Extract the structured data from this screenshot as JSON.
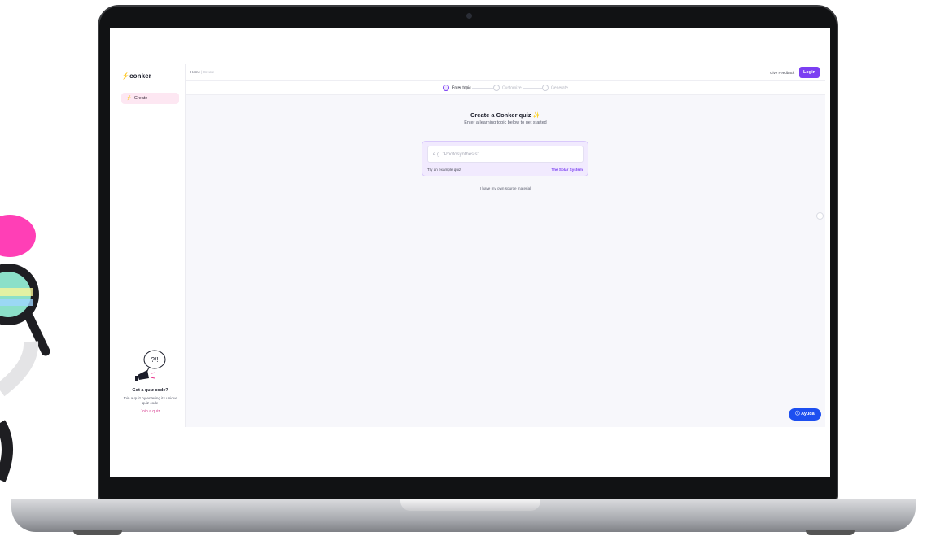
{
  "app": {
    "logo": "conker",
    "logo_icon": "bolt-icon",
    "accent_color": "#7b3ff2",
    "pink_color": "#e8318a"
  },
  "sidebar": {
    "items": [
      {
        "label": "Create",
        "icon": "bolt-icon",
        "active": true
      }
    ],
    "quiz_code": {
      "title": "Got a quiz code?",
      "text": "Join a quiz by entering its unique quiz code",
      "link": "Join a quiz",
      "illustration_text": "?/!"
    }
  },
  "header": {
    "breadcrumb": [
      "Home",
      "Create"
    ],
    "breadcrumb_separator": "|",
    "feedback_label": "Give Feedback",
    "login_label": "Login"
  },
  "steps": [
    {
      "label": "Enter topic",
      "state": "active"
    },
    {
      "label": "Customize",
      "state": "inactive"
    },
    {
      "label": "Generate",
      "state": "inactive"
    }
  ],
  "main": {
    "title": "Create a Conker quiz",
    "title_icon": "sparkle-icon",
    "subtitle": "Enter a learning topic below to get started",
    "topic_input": {
      "value": "",
      "placeholder": "e.g. \"Photosynthesis\""
    },
    "example_label": "Try an example quiz",
    "example_link": "The Solar System",
    "own_source_label": "I have my own source material"
  },
  "help_button": {
    "label": "Ayuda",
    "icon": "help-circle-icon",
    "color": "#1d4ff0"
  }
}
